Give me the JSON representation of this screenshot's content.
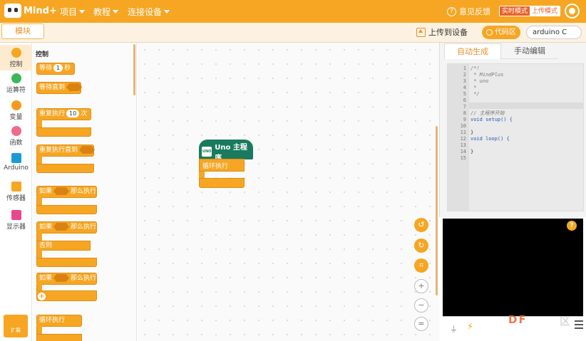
{
  "topbar": {
    "logo_text": "Mind+",
    "menus": [
      "项目",
      "教程",
      "连接设备"
    ],
    "feedback": "意见反馈",
    "mode_realtime": "实时模式",
    "mode_upload": "上传模式"
  },
  "toolbar": {
    "blocks_tab": "模块",
    "upload": "上传到设备",
    "code_btn": "代码区",
    "board": "arduino C"
  },
  "categories": [
    {
      "label": "控制",
      "color": "#f6a623"
    },
    {
      "label": "运算符",
      "color": "#3ab75a"
    },
    {
      "label": "变量",
      "color": "#f39a1e"
    },
    {
      "label": "函数",
      "color": "#f26a8a"
    },
    {
      "label": "Arduino",
      "color": "#1a9bd7"
    },
    {
      "label": "传感器",
      "color": "#f6a623"
    },
    {
      "label": "显示器",
      "color": "#e8488a"
    }
  ],
  "extension": "扩展",
  "flyout": {
    "title": "控制",
    "wait": {
      "a": "等待",
      "n": "1",
      "b": "秒"
    },
    "wait_until": "等待直到",
    "repeat": {
      "a": "重复执行",
      "n": "10",
      "b": "次"
    },
    "repeat_until": "重复执行直到",
    "if1": {
      "a": "如果",
      "b": "那么执行"
    },
    "if2": {
      "a": "如果",
      "b": "那么执行",
      "else": "否则"
    },
    "if3": {
      "a": "如果",
      "b": "那么执行"
    },
    "loop": "循环执行"
  },
  "workspace": {
    "hat_label": "Uno 主程序",
    "chip_label": "UNO",
    "loop_label": "循环执行"
  },
  "rpanel": {
    "tab_auto": "自动生成",
    "tab_manual": "手动编辑",
    "code_lines": [
      "/*!",
      " * MindPlus",
      " * uno",
      " *",
      " */",
      "",
      "",
      "// 主程序开始",
      "void setup() {",
      "",
      "}",
      "void loop() {",
      "",
      "}",
      ""
    ],
    "line_numbers": [
      "1",
      "2",
      "3",
      "4",
      "5",
      "6",
      "7",
      "8",
      "9",
      "10",
      "11",
      "12",
      "13",
      "14",
      "15"
    ]
  },
  "console": {
    "help": "?",
    "watermark": "DF",
    "watermark2": "区"
  }
}
